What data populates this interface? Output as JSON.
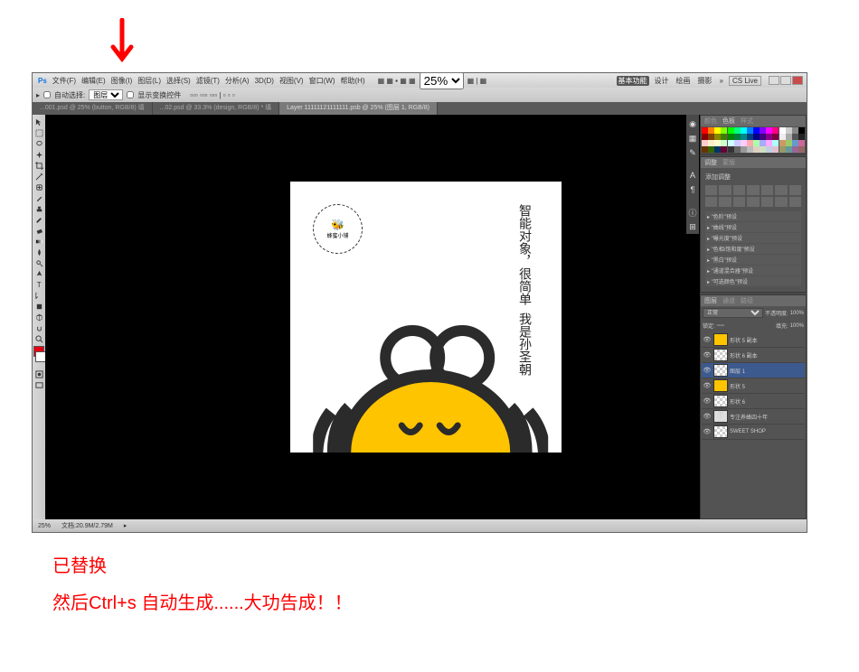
{
  "arrow_indicator": "↓",
  "menubar": {
    "items": [
      "文件(F)",
      "编辑(E)",
      "图像(I)",
      "图层(L)",
      "选择(S)",
      "滤镜(T)",
      "分析(A)",
      "3D(D)",
      "视图(V)",
      "窗口(W)",
      "帮助(H)"
    ],
    "zoom_dropdown": "25%",
    "app_title": "基本功能",
    "right_items": [
      "设计",
      "绘画",
      "摄影"
    ],
    "cs_live": "CS Live"
  },
  "optionsbar": {
    "auto_select_label": "自动选择:",
    "auto_select_value": "图层",
    "show_transform": "显示变换控件",
    "checkbox1": false,
    "checkbox2": false
  },
  "tabs": [
    {
      "label": "...001.psd @ 25% (button, RGB/8) 填",
      "active": false
    },
    {
      "label": "...02.psd @ 33.3% (design, RGB/8) * 填",
      "active": false
    },
    {
      "label": "Layer 11111121111111.psb @ 25% (图层 1, RGB/8)",
      "active": true
    }
  ],
  "canvas": {
    "logo_text": "蜂蜜小铺",
    "text_col1": "智能对象，很简单",
    "text_col2": "我是孙圣朝"
  },
  "statusbar": {
    "zoom": "25%",
    "doc_info": "文档:20.9M/2.79M"
  },
  "panels": {
    "swatches": {
      "tab1": "颜色",
      "tab2": "色板",
      "tab3": "样式"
    },
    "adjustments": {
      "tab1": "调整",
      "tab2": "蒙版",
      "label": "添加调整",
      "presets": [
        "\"色阶\"预设",
        "\"曲线\"预设",
        "\"曝光度\"预设",
        "\"色相/饱和度\"预设",
        "\"黑白\"预设",
        "\"通道混合器\"预设",
        "\"可选颜色\"预设"
      ]
    },
    "layers": {
      "tab1": "图层",
      "tab2": "通道",
      "tab3": "路径",
      "blend_mode": "正常",
      "opacity_label": "不透明度:",
      "opacity_value": "100%",
      "lock_label": "锁定:",
      "fill_label": "填充:",
      "fill_value": "100%",
      "items": [
        {
          "name": "形状 5 副本",
          "thumb": "yellow"
        },
        {
          "name": "形状 6 副本",
          "thumb": "checker"
        },
        {
          "name": "图层 1",
          "thumb": "checker",
          "selected": true
        },
        {
          "name": "形状 5",
          "thumb": "yellow"
        },
        {
          "name": "形状 6",
          "thumb": "checker"
        },
        {
          "name": "专注养蜂四十年",
          "thumb": "text"
        },
        {
          "name": "SWEET SHOP",
          "thumb": "checker"
        }
      ]
    }
  },
  "captions": {
    "line1": "已替换",
    "line2": "然后Ctrl+s 自动生成......大功告成！！"
  },
  "swatch_colors": [
    "#f00",
    "#ff8000",
    "#ff0",
    "#80ff00",
    "#0f0",
    "#00ff80",
    "#0ff",
    "#0080ff",
    "#00f",
    "#8000ff",
    "#f0f",
    "#ff0080",
    "#fff",
    "#ccc",
    "#888",
    "#000",
    "#800",
    "#804000",
    "#880",
    "#408000",
    "#080",
    "#008040",
    "#088",
    "#004080",
    "#008",
    "#400080",
    "#808",
    "#800040",
    "#eee",
    "#aaa",
    "#555",
    "#222",
    "#fcc",
    "#fec",
    "#ffc",
    "#cfc",
    "#cff",
    "#ccf",
    "#fcf",
    "#faa",
    "#afa",
    "#aaf",
    "#faf",
    "#aff",
    "#c96",
    "#9c6",
    "#69c",
    "#c69",
    "#630",
    "#360",
    "#036",
    "#603",
    "#333",
    "#666",
    "#999",
    "#bbb",
    "#e0d0c0",
    "#d0e0c0",
    "#c0d0e0",
    "#e0c0d0",
    "#996",
    "#699",
    "#969",
    "#966"
  ]
}
